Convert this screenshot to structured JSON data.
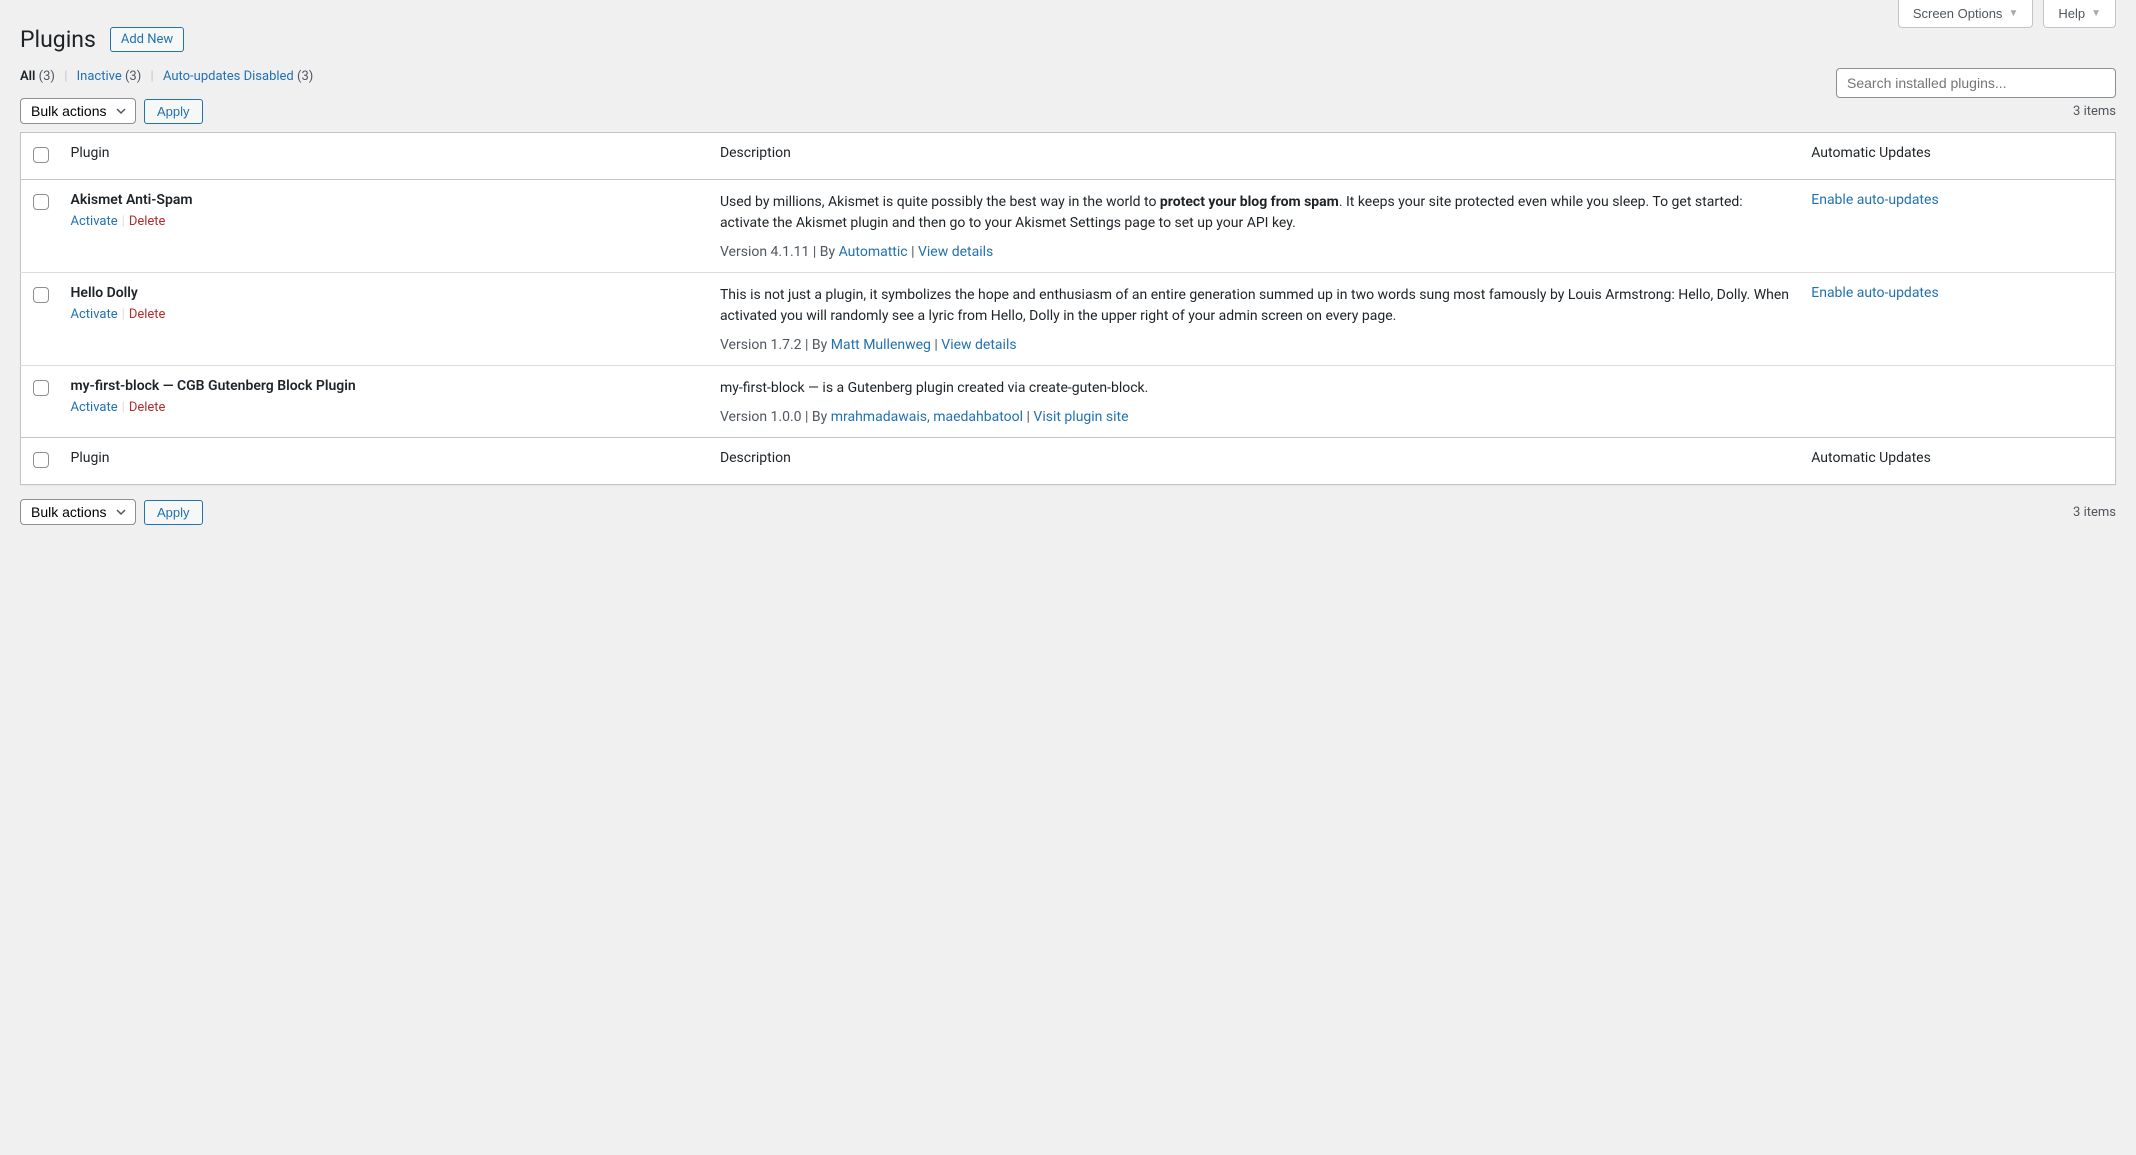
{
  "top_tabs": {
    "screen_options": "Screen Options",
    "help": "Help"
  },
  "page": {
    "title": "Plugins",
    "add_new": "Add New"
  },
  "filters": {
    "all_label": "All",
    "all_count": "(3)",
    "inactive_label": "Inactive",
    "inactive_count": "(3)",
    "auto_disabled_label": "Auto-updates Disabled",
    "auto_disabled_count": "(3)"
  },
  "search": {
    "placeholder": "Search installed plugins..."
  },
  "bulk": {
    "select_label": "Bulk actions",
    "apply": "Apply"
  },
  "pagination": {
    "items_text": "3 items"
  },
  "columns": {
    "plugin": "Plugin",
    "description": "Description",
    "auto_updates": "Automatic Updates"
  },
  "actions": {
    "activate": "Activate",
    "delete": "Delete",
    "enable_auto": "Enable auto-updates"
  },
  "plugins": [
    {
      "name": "Akismet Anti-Spam",
      "desc_pre": "Used by millions, Akismet is quite possibly the best way in the world to ",
      "desc_bold": "protect your blog from spam",
      "desc_post": ". It keeps your site protected even while you sleep. To get started: activate the Akismet plugin and then go to your Akismet Settings page to set up your API key.",
      "version": "Version 4.1.11",
      "by": "By ",
      "author": "Automattic",
      "details_link": "View details",
      "show_auto_update": true
    },
    {
      "name": "Hello Dolly",
      "desc_pre": "This is not just a plugin, it symbolizes the hope and enthusiasm of an entire generation summed up in two words sung most famously by Louis Armstrong: Hello, Dolly. When activated you will randomly see a lyric from Hello, Dolly in the upper right of your admin screen on every page.",
      "desc_bold": "",
      "desc_post": "",
      "version": "Version 1.7.2",
      "by": "By ",
      "author": "Matt Mullenweg",
      "details_link": "View details",
      "show_auto_update": true
    },
    {
      "name": "my-first-block — CGB Gutenberg Block Plugin",
      "desc_pre": "my-first-block — is a Gutenberg plugin created via create-guten-block.",
      "desc_bold": "",
      "desc_post": "",
      "version": "Version 1.0.0",
      "by": "By ",
      "author": "mrahmadawais, maedahbatool",
      "details_link": "Visit plugin site",
      "show_auto_update": false
    }
  ]
}
